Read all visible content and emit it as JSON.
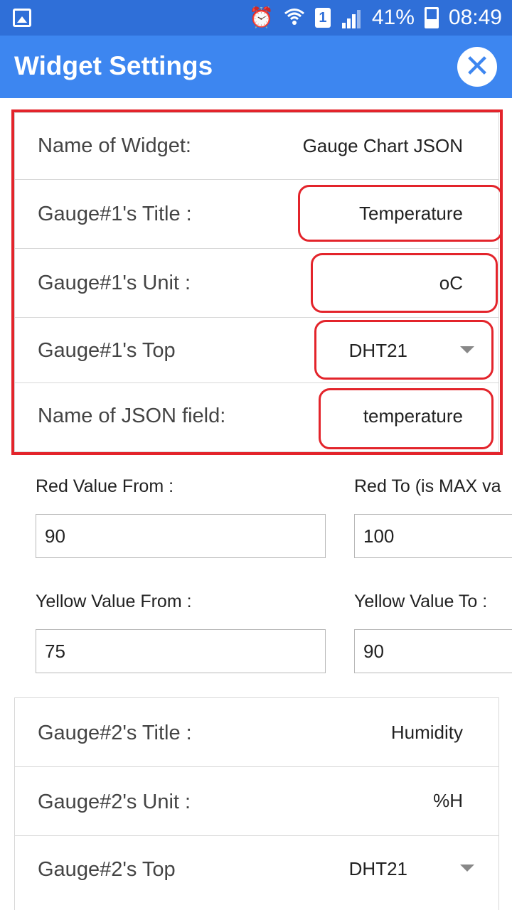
{
  "status_bar": {
    "battery": "41%",
    "time": "08:49",
    "sim_label": "1",
    "icons": [
      "image-icon",
      "alarm-icon",
      "wifi-icon",
      "sim-icon",
      "signal-icon",
      "battery-icon"
    ]
  },
  "app_bar": {
    "title": "Widget Settings",
    "close_icon": "close-icon"
  },
  "widget_settings": {
    "name_label": "Name of Widget:",
    "name_value": "Gauge Chart JSON",
    "g1_title_label": "Gauge#1's Title :",
    "g1_title_value": "Temperature",
    "g1_unit_label": "Gauge#1's Unit :",
    "g1_unit_value": "oC",
    "g1_topic_label": "Gauge#1's Top",
    "g1_topic_value": "DHT21",
    "json_field_label": "Name of JSON field:",
    "json_field_value": "temperature"
  },
  "ranges": {
    "red_from_label": "Red Value From :",
    "red_from_value": "90",
    "red_to_label": "Red To (is MAX va",
    "red_to_value": "100",
    "yellow_from_label": "Yellow Value From :",
    "yellow_from_value": "75",
    "yellow_to_label": "Yellow Value To :",
    "yellow_to_value": "90"
  },
  "gauge2": {
    "title_label": "Gauge#2's Title :",
    "title_value": "Humidity",
    "unit_label": "Gauge#2's Unit :",
    "unit_value": "%H",
    "topic_label": "Gauge#2's Top",
    "topic_value": "DHT21"
  },
  "colors": {
    "status_bar": "#2f6fd8",
    "app_bar": "#3d86f0",
    "highlight": "#e3242b"
  }
}
